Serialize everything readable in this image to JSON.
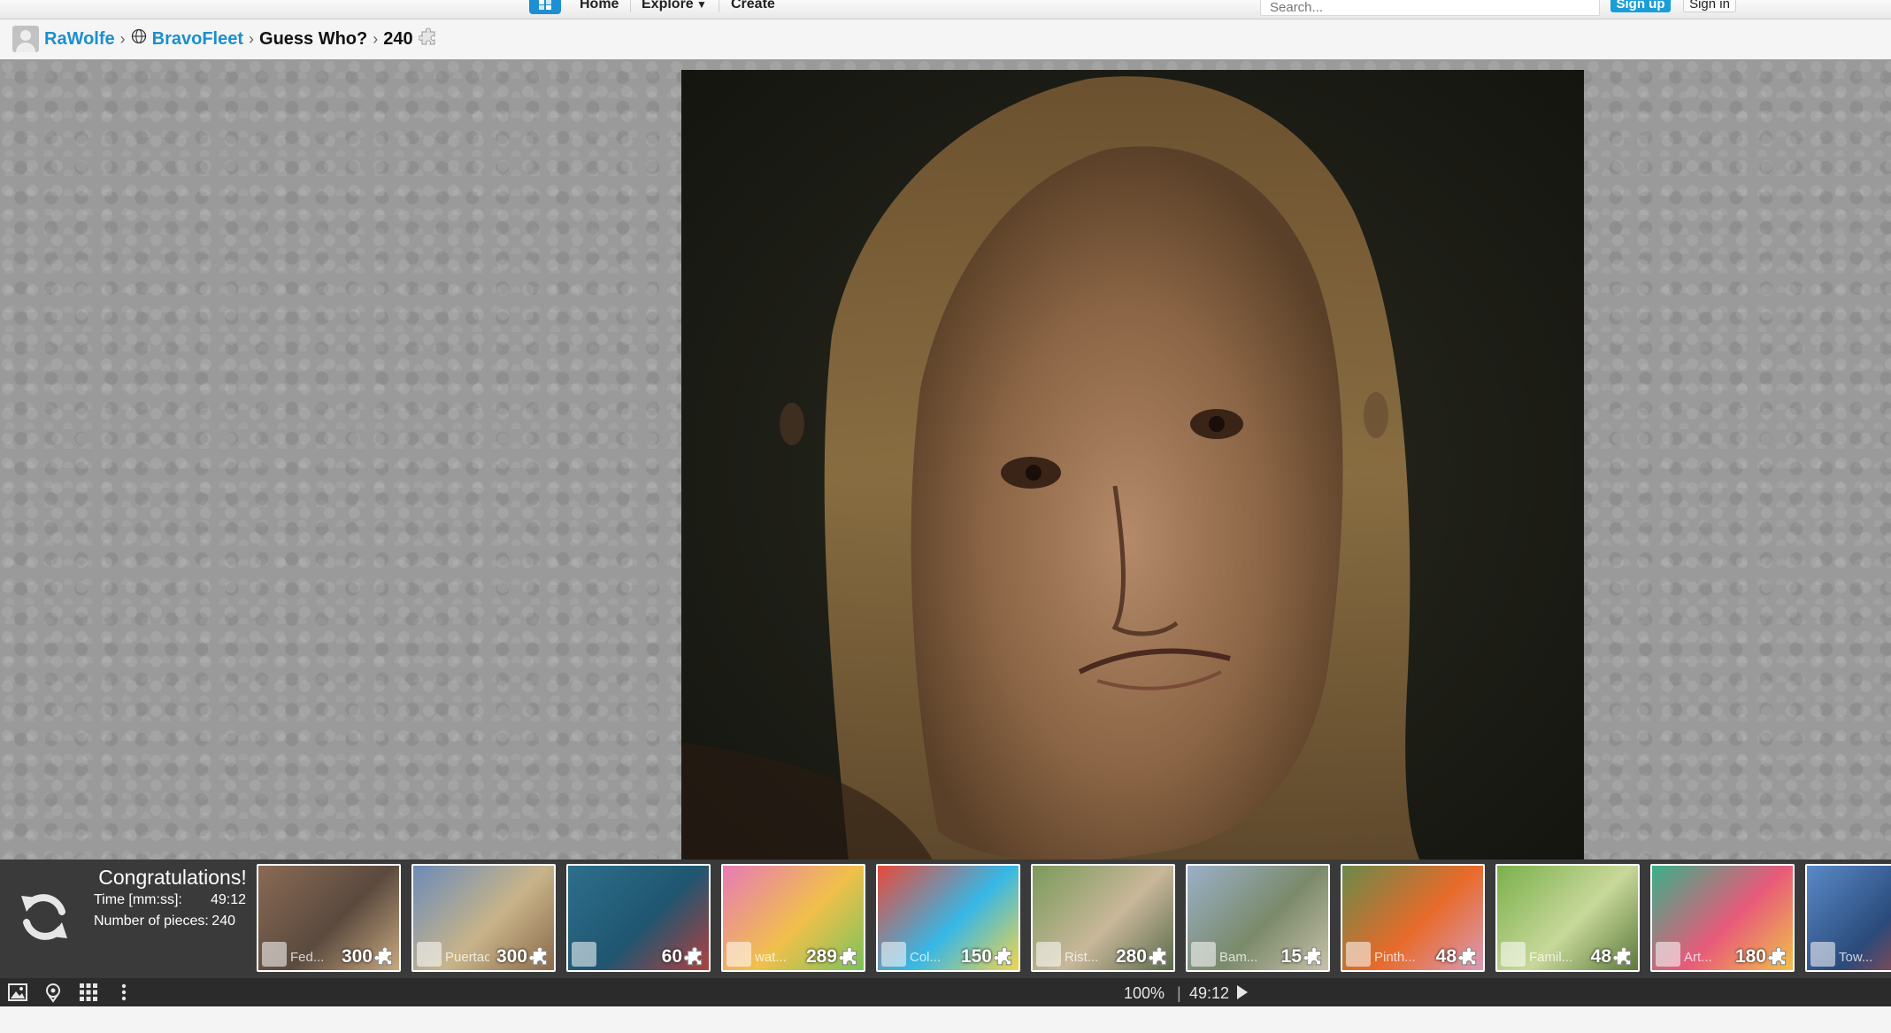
{
  "nav": {
    "home_label": "Home",
    "explore_label": "Explore",
    "create_label": "Create",
    "search_placeholder": "Search...",
    "signup_label": "Sign up",
    "signin_label": "Sign in"
  },
  "breadcrumb": {
    "user": "RaWolfe",
    "group": "BravoFleet",
    "puzzle_title": "Guess Who?",
    "pieces": "240"
  },
  "congrats": {
    "title": "Congratulations!",
    "time_label": "Time [mm:ss]:",
    "time_value": "49:12",
    "pieces_label": "Number of pieces:",
    "pieces_value": "240"
  },
  "thumbnails": [
    {
      "name": "Fed...",
      "count": "300",
      "colors": [
        "#8a6a55",
        "#5a4a3e",
        "#c9a77f"
      ]
    },
    {
      "name": "Puertac...",
      "count": "300",
      "colors": [
        "#6c8bb8",
        "#c8b48a",
        "#8a6a4a"
      ]
    },
    {
      "name": "",
      "count": "60",
      "colors": [
        "#2e6f8c",
        "#1f5670",
        "#b04040"
      ]
    },
    {
      "name": "wat...",
      "count": "289",
      "colors": [
        "#e77ab6",
        "#f1c04b",
        "#7ac25a"
      ]
    },
    {
      "name": "Col...",
      "count": "150",
      "colors": [
        "#e84a3a",
        "#36b7e6",
        "#f2d54a"
      ]
    },
    {
      "name": "Rist...",
      "count": "280",
      "colors": [
        "#7a9a5a",
        "#c9b79a",
        "#5a6a4a"
      ]
    },
    {
      "name": "Bam...",
      "count": "15",
      "colors": [
        "#9ab0c8",
        "#7a8a6a",
        "#c8c0a8"
      ]
    },
    {
      "name": "Pinth...",
      "count": "48",
      "colors": [
        "#6a8a4a",
        "#e86a2a",
        "#d89ab8"
      ]
    },
    {
      "name": "Famil...",
      "count": "48",
      "colors": [
        "#7ab04a",
        "#c8d89a",
        "#5a7a3a"
      ]
    },
    {
      "name": "Art...",
      "count": "180",
      "colors": [
        "#3ab08a",
        "#e85a7a",
        "#f0c04a"
      ]
    },
    {
      "name": "Tow...",
      "count": "",
      "colors": [
        "#5a8ac8",
        "#2a4a7a",
        "#c84a3a"
      ]
    }
  ],
  "status": {
    "zoom": "100%",
    "separator": "|",
    "timer": "49:12"
  },
  "icons": {
    "logo": "puzzle-logo-icon",
    "reload": "reload-icon",
    "image": "image-icon",
    "ghost": "ghost-image-icon",
    "pieces": "pieces-grid-icon",
    "menu": "more-menu-icon",
    "play": "play-icon"
  }
}
